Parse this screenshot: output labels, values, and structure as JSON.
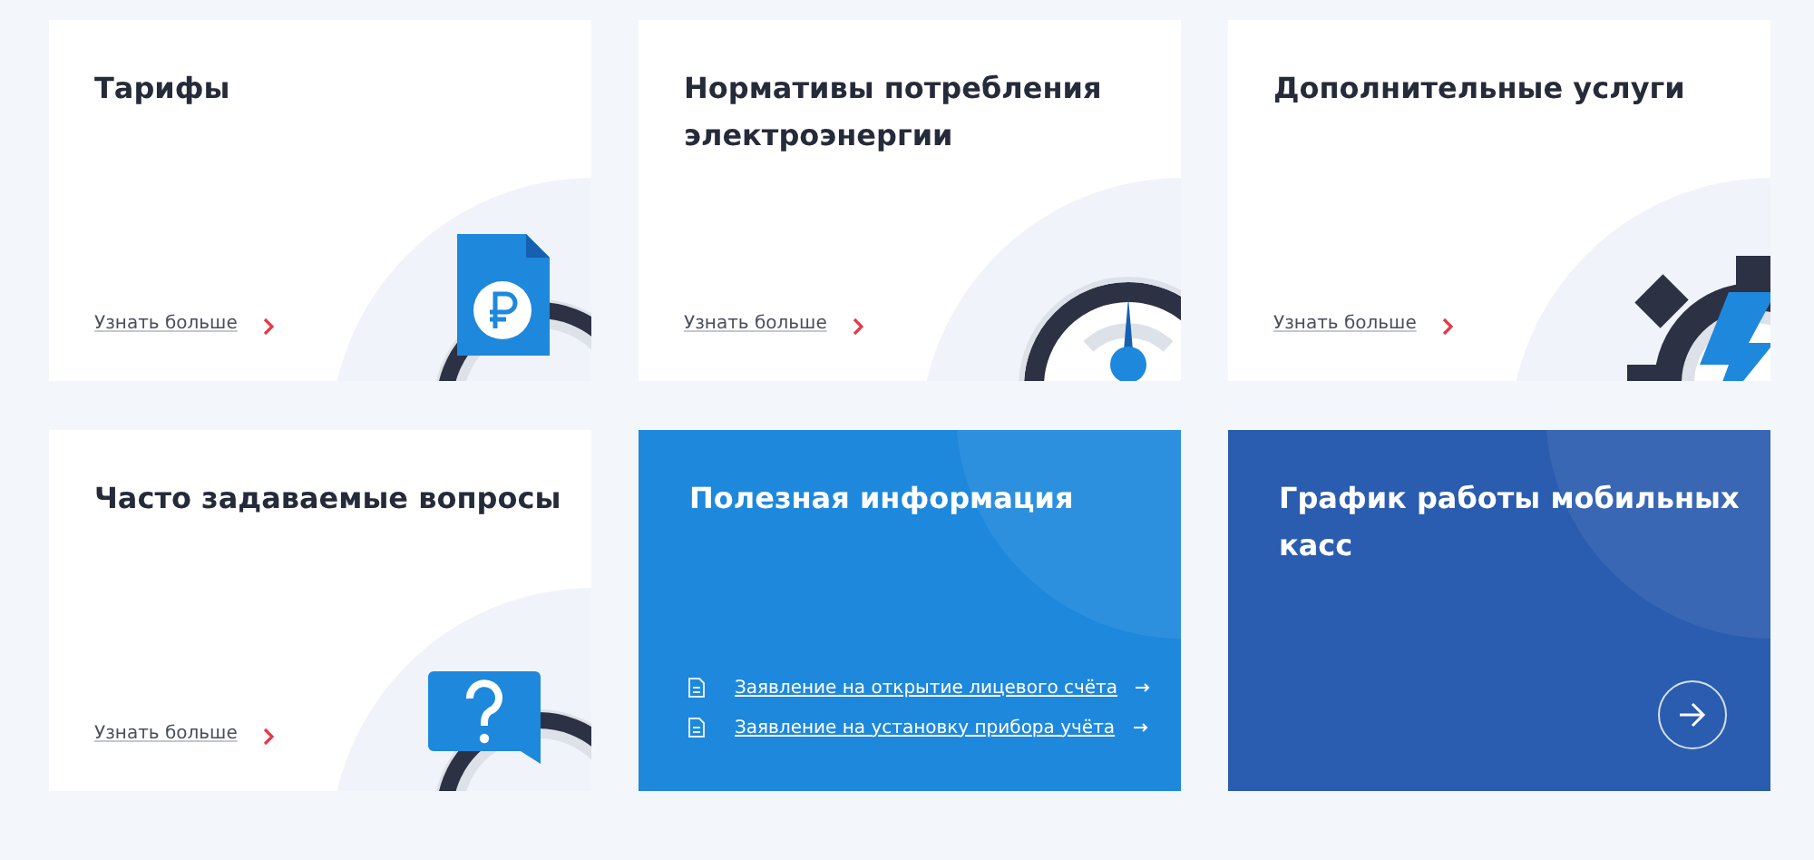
{
  "cards": [
    {
      "kind": "rouble-document",
      "title": "Тарифы",
      "link": "Узнать больше"
    },
    {
      "kind": "gauge",
      "title": "Нормативы потребления электроэнергии",
      "link": "Узнать больше"
    },
    {
      "kind": "gear",
      "title": "Дополнительные услуги",
      "link": "Узнать больше"
    },
    {
      "kind": "question",
      "title": "Часто задаваемые вопросы",
      "link": "Узнать больше"
    },
    {
      "kind": "documents",
      "title": "Полезная информация",
      "links": [
        "Заявление на открытие лицевого счёта",
        "Заявление на установку прибора учёта"
      ]
    },
    {
      "kind": "arrow",
      "title": "График работы мобильных касс"
    }
  ]
}
